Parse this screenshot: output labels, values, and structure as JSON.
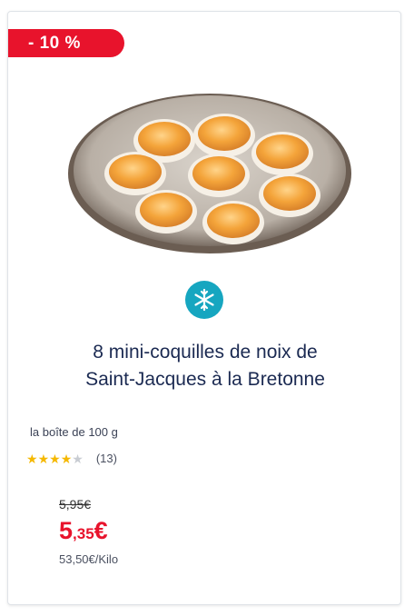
{
  "badge": {
    "label": "- 10 %"
  },
  "product": {
    "title_line1": "8 mini-coquilles de noix de",
    "title_line2": "Saint-Jacques à la Bretonne",
    "pack_size": "la boîte de 100 g",
    "frozen_icon": "snowflake-icon"
  },
  "rating": {
    "stars_filled": 4,
    "stars_total": 5,
    "review_count": "(13)"
  },
  "price": {
    "old": "5,95€",
    "new_int": "5",
    "new_dec": ",35",
    "new_currency": "€",
    "unit": "53,50€/Kilo"
  },
  "colors": {
    "accent_red": "#e8132c",
    "title_navy": "#1b2a52",
    "frozen_teal": "#16a6c0",
    "star_gold": "#f5b800"
  }
}
